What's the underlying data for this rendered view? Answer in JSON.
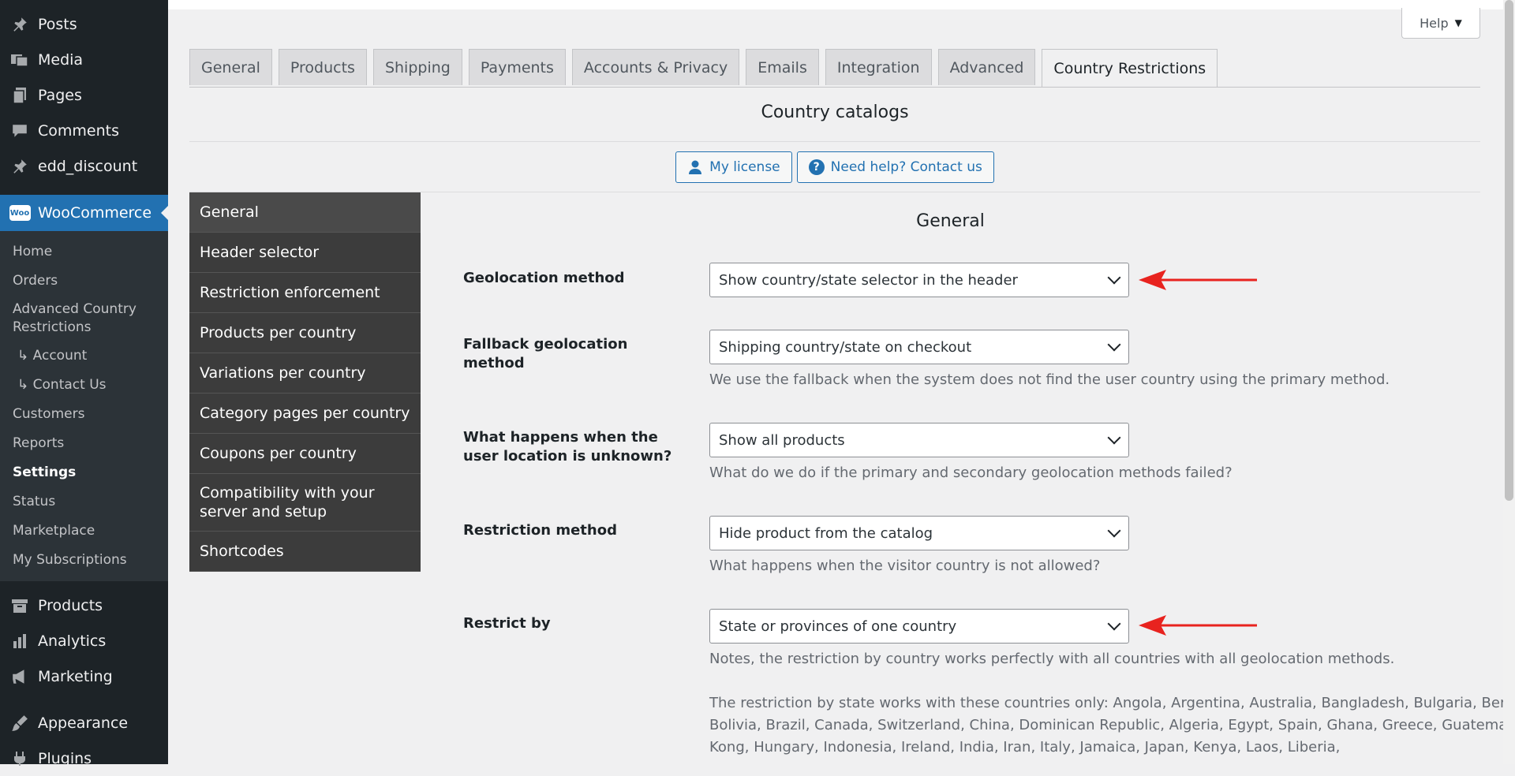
{
  "sidebar": {
    "top_items": [
      {
        "label": "Posts",
        "icon": "pin-icon"
      },
      {
        "label": "Media",
        "icon": "media-icon"
      },
      {
        "label": "Pages",
        "icon": "pages-icon"
      },
      {
        "label": "Comments",
        "icon": "comment-icon"
      },
      {
        "label": "edd_discount",
        "icon": "pin-icon"
      }
    ],
    "woocommerce": {
      "label": "WooCommerce",
      "logo_text": "Woo"
    },
    "submenu": [
      {
        "label": "Home"
      },
      {
        "label": "Orders"
      },
      {
        "label": "Advanced Country Restrictions"
      },
      {
        "label": "↳ Account"
      },
      {
        "label": "↳ Contact Us"
      },
      {
        "label": "Customers"
      },
      {
        "label": "Reports"
      },
      {
        "label": "Settings",
        "current": true
      },
      {
        "label": "Status"
      },
      {
        "label": "Marketplace"
      },
      {
        "label": "My Subscriptions"
      }
    ],
    "bottom_items": [
      {
        "label": "Products",
        "icon": "archive-icon"
      },
      {
        "label": "Analytics",
        "icon": "bar-chart-icon"
      },
      {
        "label": "Marketing",
        "icon": "megaphone-icon"
      },
      {
        "label": "Appearance",
        "icon": "brush-icon"
      },
      {
        "label": "Plugins",
        "icon": "plugin-icon"
      }
    ]
  },
  "help": {
    "label": "Help",
    "caret": "▼"
  },
  "tabs": [
    {
      "label": "General"
    },
    {
      "label": "Products"
    },
    {
      "label": "Shipping"
    },
    {
      "label": "Payments"
    },
    {
      "label": "Accounts & Privacy"
    },
    {
      "label": "Emails"
    },
    {
      "label": "Integration"
    },
    {
      "label": "Advanced"
    },
    {
      "label": "Country Restrictions",
      "active": true
    }
  ],
  "page_title": "Country catalogs",
  "buttons": {
    "license": {
      "label": "My license",
      "icon": "user-icon"
    },
    "help": {
      "label": "Need help? Contact us",
      "icon": "question-icon",
      "glyph": "?"
    }
  },
  "settings_menu": [
    {
      "label": "General",
      "active": true
    },
    {
      "label": "Header selector"
    },
    {
      "label": "Restriction enforcement"
    },
    {
      "label": "Products per country"
    },
    {
      "label": "Variations per country"
    },
    {
      "label": "Category pages per country"
    },
    {
      "label": "Coupons per country"
    },
    {
      "label": "Compatibility with your server and setup"
    },
    {
      "label": "Shortcodes"
    }
  ],
  "section_title": "General",
  "fields": {
    "geolocation": {
      "label": "Geolocation method",
      "value": "Show country/state selector in the header"
    },
    "fallback": {
      "label": "Fallback geolocation method",
      "value": "Shipping country/state on checkout",
      "desc": "We use the fallback when the system does not find the user country using the primary method."
    },
    "unknown": {
      "label": "What happens when the user location is unknown?",
      "value": "Show all products",
      "desc": "What do we do if the primary and secondary geolocation methods failed?"
    },
    "restriction": {
      "label": "Restriction method",
      "value": "Hide product from the catalog",
      "desc": "What happens when the visitor country is not allowed?"
    },
    "restrict_by": {
      "label": "Restrict by",
      "value": "State or provinces of one country",
      "desc": "Notes, the restriction by country works perfectly with all countries with all geolocation methods.",
      "desc2": "The restriction by state works with these countries only: Angola, Argentina, Australia, Bangladesh, Bulgaria, Benin, Bolivia, Brazil, Canada, Switzerland, China, Dominican Republic, Algeria, Egypt, Spain, Ghana, Greece, Guatemala, Hong Kong, Hungary, Indonesia, Ireland, India, Iran, Italy, Jamaica, Japan, Kenya, Laos, Liberia,"
    }
  },
  "colors": {
    "arrow": "#e8231f",
    "accent": "#2271b1"
  }
}
